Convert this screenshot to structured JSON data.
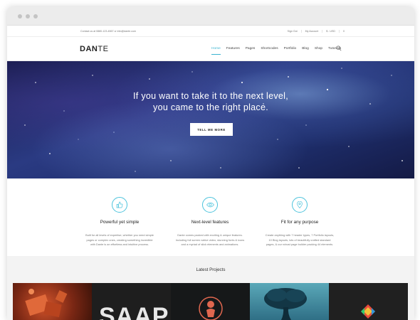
{
  "topbar": {
    "contact": "Contact us at 0880-123-4567 or info@dante.com",
    "links": [
      "Sign Out",
      "My Account",
      "$ - USD",
      "0"
    ]
  },
  "logo": {
    "bold": "DAN",
    "light": "TE"
  },
  "menu": [
    {
      "label": "Home",
      "active": true
    },
    {
      "label": "Features",
      "active": false
    },
    {
      "label": "Pages",
      "active": false
    },
    {
      "label": "Shortcodes",
      "active": false
    },
    {
      "label": "Portfolio",
      "active": false
    },
    {
      "label": "Blog",
      "active": false
    },
    {
      "label": "Shop",
      "active": false
    },
    {
      "label": "Tutorials",
      "active": false
    }
  ],
  "hero": {
    "line1": "If you want to take it to the next level,",
    "line2": "you came to the right place.",
    "button": "TELL ME MORE"
  },
  "features": [
    {
      "icon": "thumbs-up-icon",
      "title": "Powerful yet simple",
      "lines": [
        "Built for all levels of expertise, whether you need simple",
        "pages or complex ones, creating something incredible",
        "with Dante is an effortless and intuitive process."
      ]
    },
    {
      "icon": "eye-icon",
      "title": "Next-level features",
      "lines": [
        "Dante comes packed with exciting & unique features.",
        "Including full screen native video, stunning fonts & icons",
        "and a myriad of slick elements and animations."
      ]
    },
    {
      "icon": "map-pin-icon",
      "title": "Fit for any purpose",
      "lines": [
        "Create anything with 7 header types, 7 Portfolio layouts,",
        "10 Blog layouts, lots of beautifully crafted standard",
        "pages, & our robust page builder packing 44 elements."
      ]
    }
  ],
  "projects": {
    "title": "Latest Projects",
    "tile_text": "SAAP"
  },
  "colors": {
    "accent": "#3bb4d1",
    "hero_dark": "#1e2e6c"
  }
}
